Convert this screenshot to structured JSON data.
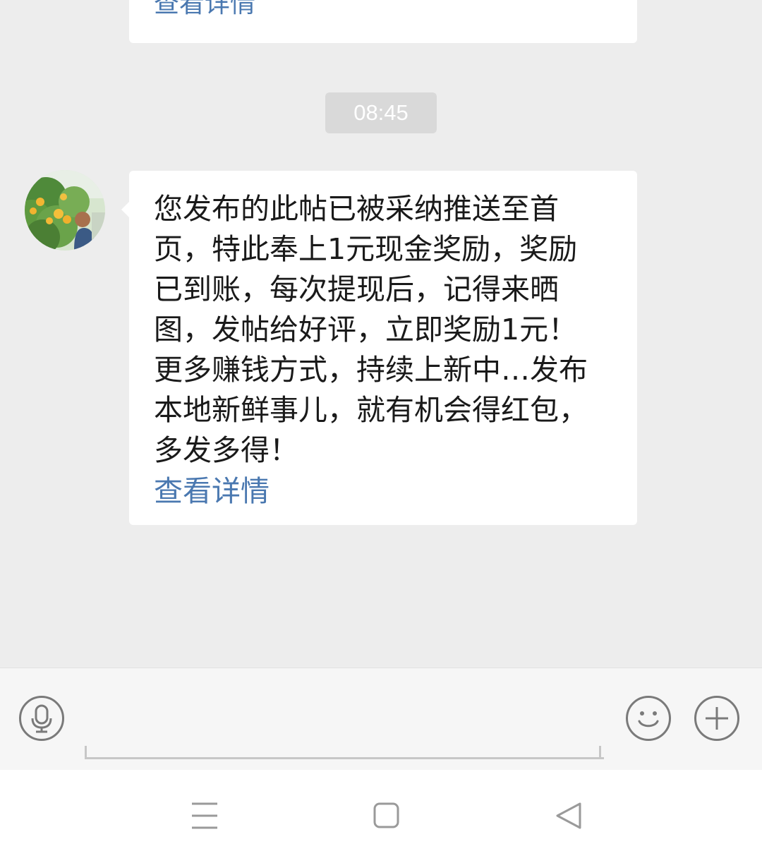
{
  "previous_message": {
    "link_label": "查看详情"
  },
  "timestamp": "08:45",
  "message": {
    "text": "您发布的此帖已被采纳推送至首页，特此奉上1元现金奖励，奖励已到账，每次提现后，记得来晒图，发帖给好评，立即奖励1元！更多赚钱方式，持续上新中…发布本地新鲜事儿，就有机会得红包，多发多得！",
    "link_label": "查看详情"
  },
  "input_bar": {
    "input_value": "",
    "icons": [
      "microphone-icon",
      "smiley-icon",
      "plus-icon"
    ]
  },
  "nav_bar": {
    "icons": [
      "menu-icon",
      "home-square-icon",
      "back-triangle-icon"
    ]
  },
  "colors": {
    "background": "#ededed",
    "bubble": "#ffffff",
    "link": "#4a78b0",
    "timestamp_bg": "#d9d9d9"
  }
}
